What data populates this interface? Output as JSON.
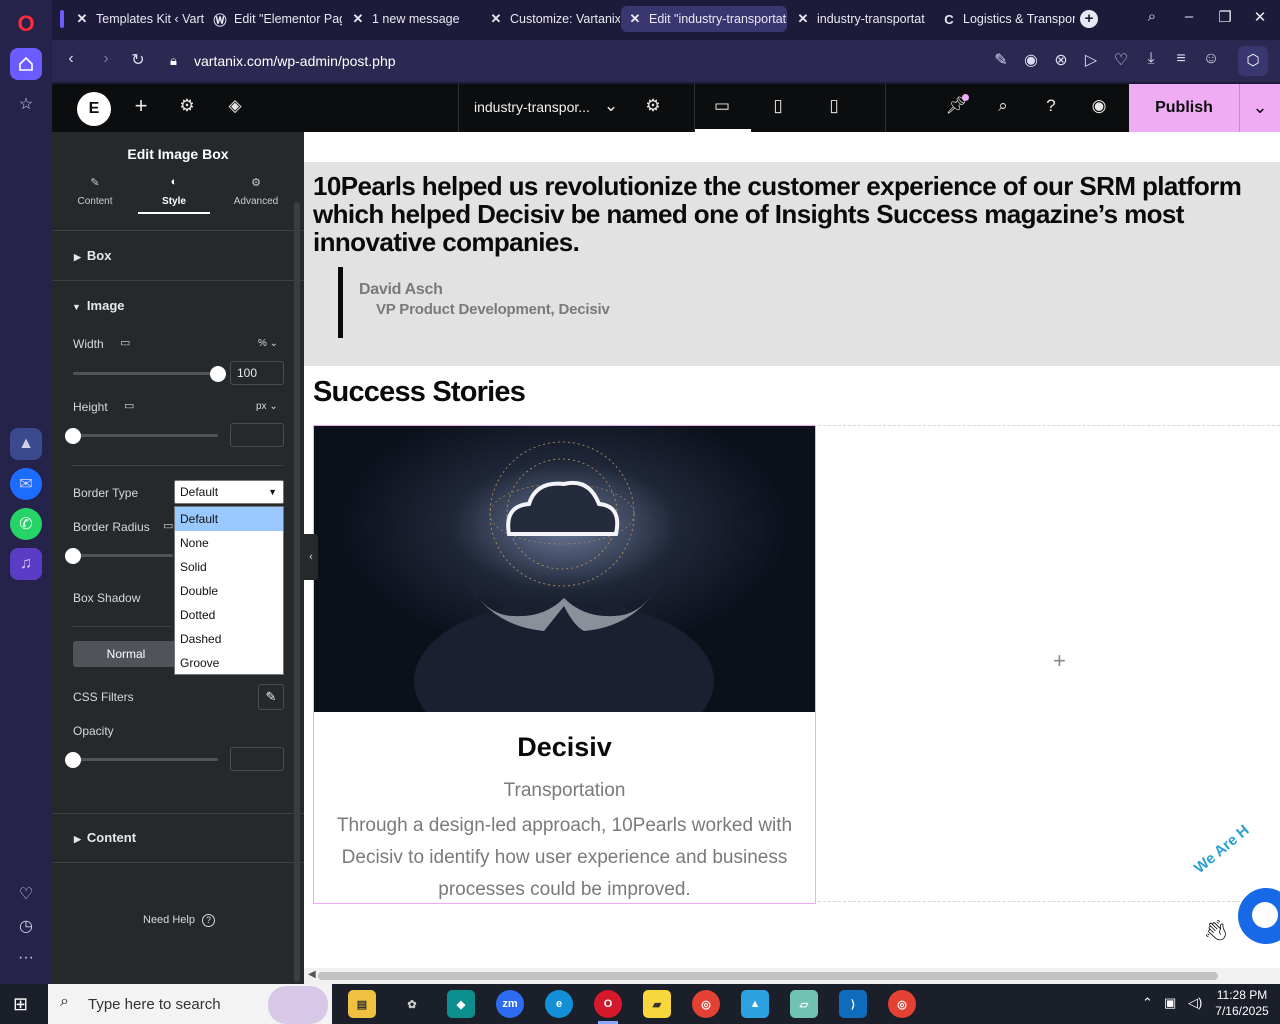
{
  "browser": {
    "tabs": [
      {
        "label": "Templates Kit ‹ Vartani",
        "icon": "x-logo-icon"
      },
      {
        "label": "Edit \"Elementor Page",
        "icon": "wordpress-icon"
      },
      {
        "label": "1 new message",
        "icon": "x-logo-icon"
      },
      {
        "label": "Customize: Vartanix",
        "icon": "x-logo-icon"
      },
      {
        "label": "Edit \"industry-transportati",
        "icon": "x-logo-icon"
      },
      {
        "label": "industry-transportati",
        "icon": "x-logo-icon"
      },
      {
        "label": "Logistics & Transport",
        "icon": "c-logo-icon"
      }
    ],
    "url": "vartanix.com/wp-admin/post.php"
  },
  "editor": {
    "page_name": "industry-transpor...",
    "publish_label": "Publish"
  },
  "panel": {
    "title": "Edit Image Box",
    "tabs": [
      "Content",
      "Style",
      "Advanced"
    ],
    "section_box": "Box",
    "section_image": "Image",
    "width_label": "Width",
    "width_unit": "% ⌄",
    "width_value": "100",
    "width_fraction": 1.0,
    "height_label": "Height",
    "height_unit": "px ⌄",
    "border_type_label": "Border Type",
    "border_type_value": "Default",
    "border_type_options": [
      "Default",
      "None",
      "Solid",
      "Double",
      "Dotted",
      "Dashed",
      "Groove"
    ],
    "border_radius_label": "Border Radius",
    "box_shadow_label": "Box Shadow",
    "normal_label": "Normal",
    "css_filters_label": "CSS Filters",
    "opacity_label": "Opacity",
    "section_content": "Content",
    "need_help": "Need Help"
  },
  "preview": {
    "quote": "10Pearls helped us revolutionize the customer experience of our SRM platform which helped Decisiv be named one of Insights Success magazine’s most innovative companies.",
    "author_name": "David Asch",
    "author_title": "VP Product Development, Decisiv",
    "section_title": "Success Stories",
    "card_title": "Decisiv",
    "card_category": "Transportation",
    "card_text": "Through a design-led approach, 10Pearls worked with Decisiv to identify how user experience and business processes could be improved.",
    "badge_text": "We Are H"
  },
  "taskbar": {
    "search_placeholder": "Type here to search",
    "time": "11:28 PM",
    "date": "7/16/2025"
  },
  "colors": {
    "publish_bg": "#f0abf5",
    "quote_bg": "#e2e2e2",
    "browser_dark": "#1e1b3a"
  }
}
